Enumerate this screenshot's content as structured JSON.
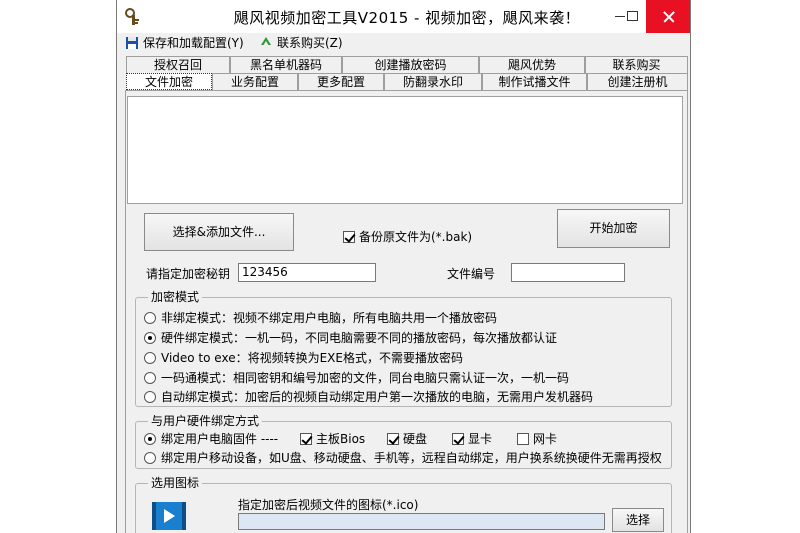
{
  "window": {
    "title": "飓风视频加密工具V2015 - 视频加密，飓风来袭！"
  },
  "menu": {
    "save": "保存和加载配置(Y)",
    "buy": "联系购买(Z)"
  },
  "tabs_row1": [
    "授权召回",
    "黑名单机器码",
    "创建播放密码",
    "飓风优势",
    "联系购买"
  ],
  "tabs_row2": [
    "文件加密",
    "业务配置",
    "更多配置",
    "防翻录水印",
    "制作试播文件",
    "创建注册机"
  ],
  "actions": {
    "select_files": "选择&添加文件...",
    "backup_label": "备份原文件为(*.bak)",
    "backup_checked": true,
    "start_encrypt": "开始加密"
  },
  "fields": {
    "key_label": "请指定加密秘钥",
    "key_value": "123456",
    "file_no_label": "文件编号",
    "file_no_value": ""
  },
  "encrypt_mode": {
    "title": "加密模式",
    "options": [
      {
        "label": "非绑定模式：视频不绑定用户电脑，所有电脑共用一个播放密码",
        "selected": false
      },
      {
        "label": "硬件绑定模式：一机一码，不同电脑需要不同的播放密码，每次播放都认证",
        "selected": true
      },
      {
        "label": "Video to exe：将视频转换为EXE格式，不需要播放密码",
        "selected": false
      },
      {
        "label": "一码通模式：相同密钥和编号加密的文件，同台电脑只需认证一次，一机一码",
        "selected": false
      },
      {
        "label": "自动绑定模式：加密后的视频自动绑定用户第一次播放的电脑，无需用户发机器码",
        "selected": false
      }
    ]
  },
  "hardware_bind": {
    "title": "与用户硬件绑定方式",
    "fixed_label": "绑定用户电脑固件 ----",
    "fixed_selected": true,
    "parts": [
      {
        "label": "主板Bios",
        "checked": true
      },
      {
        "label": "硬盘",
        "checked": true
      },
      {
        "label": "显卡",
        "checked": true
      },
      {
        "label": "网卡",
        "checked": false
      }
    ],
    "mobile_label": "绑定用户移动设备，如U盘、移动硬盘、手机等，远程自动绑定，用户换系统换硬件无需再授权",
    "mobile_selected": false
  },
  "icon_section": {
    "title": "选用图标",
    "hint": "指定加密后视频文件的图标(*.ico)",
    "path_value": "",
    "select_button": "选择"
  }
}
